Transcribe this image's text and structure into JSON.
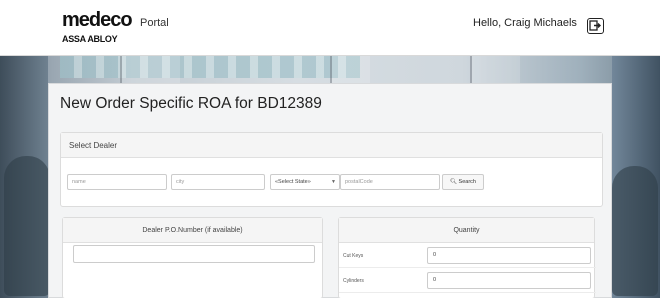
{
  "header": {
    "logo_main": "medeco",
    "logo_sub": "ASSA ABLOY",
    "portal_label": "Portal",
    "greeting": "Hello, Craig Michaels"
  },
  "page": {
    "title": "New Order Specific ROA for BD12389"
  },
  "dealer": {
    "heading": "Select Dealer",
    "name_placeholder": "name",
    "city_placeholder": "city",
    "state_selected": "«Select State»",
    "postal_placeholder": "postalCode",
    "search_label": "Search"
  },
  "po": {
    "heading": "Dealer P.O.Number (if available)",
    "value": ""
  },
  "quantity": {
    "heading": "Quantity",
    "rows": [
      {
        "label": "Cut Keys",
        "value": "0"
      },
      {
        "label": "Cylinders",
        "value": "0"
      }
    ]
  }
}
